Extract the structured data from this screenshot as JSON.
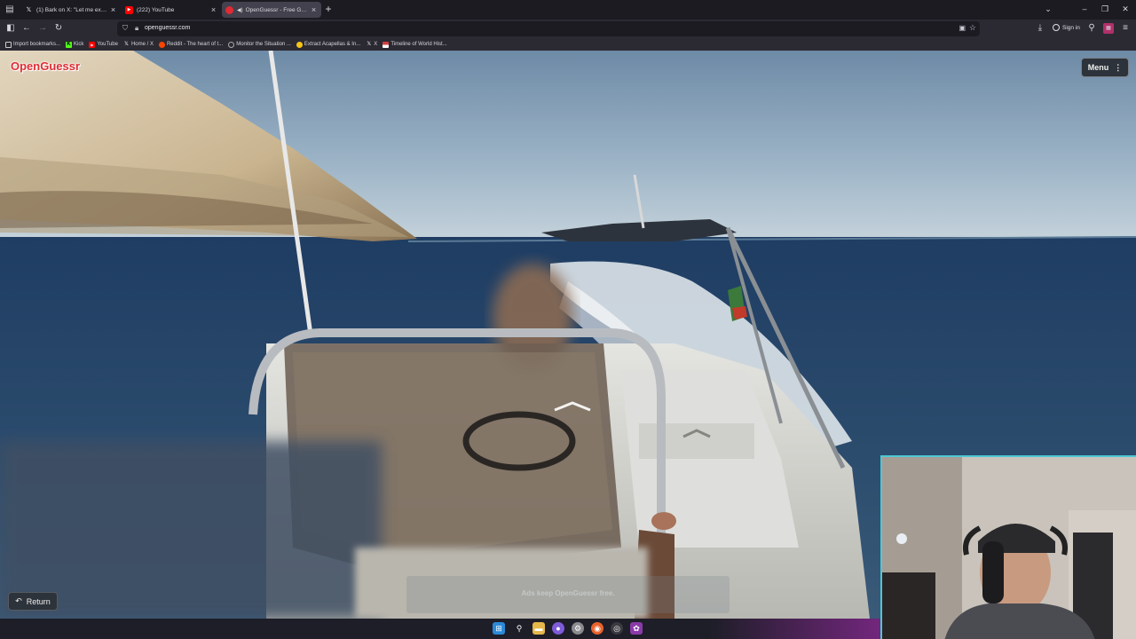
{
  "browser": {
    "tabs": [
      {
        "title": "(1) Bark on X: \"Let me explain w",
        "favicon": "x-icon",
        "active": false
      },
      {
        "title": "(222) YouTube",
        "favicon": "youtube-icon",
        "active": false
      },
      {
        "title": "OpenGuessr - Free GeoGu",
        "favicon": "openguessr-icon",
        "active": true
      }
    ],
    "url": "openguessr.com",
    "signin_label": "Sign in"
  },
  "bookmarks": [
    {
      "label": "Import bookmarks...",
      "icon": "import-icon",
      "color": "#cccccc"
    },
    {
      "label": "Kick",
      "icon": "kick-icon",
      "color": "#53fc18"
    },
    {
      "label": "YouTube",
      "icon": "youtube-icon",
      "color": "#ff0000"
    },
    {
      "label": "Home / X",
      "icon": "x-icon",
      "color": "#ffffff"
    },
    {
      "label": "Reddit - The heart of t...",
      "icon": "reddit-icon",
      "color": "#ff4500"
    },
    {
      "label": "Monitor the Situation ...",
      "icon": "globe-icon",
      "color": "#aaaaaa"
    },
    {
      "label": "Extract Acapellas & In...",
      "icon": "music-icon",
      "color": "#f5c518"
    },
    {
      "label": "X",
      "icon": "x-icon",
      "color": "#ffffff"
    },
    {
      "label": "Timeline of World Hist...",
      "icon": "flag-icon",
      "color": "#d04040"
    }
  ],
  "game": {
    "logo": "OpenGuessr",
    "menu_label": "Menu",
    "return_label": "Return",
    "ad_text": "Ads keep OpenGuessr free."
  },
  "colors": {
    "brand": "#e02b34",
    "accent_webcam_border": "#4ec8d4",
    "firefox_bg": "#1c1b22",
    "toolbar_bg": "#2b2a33"
  }
}
